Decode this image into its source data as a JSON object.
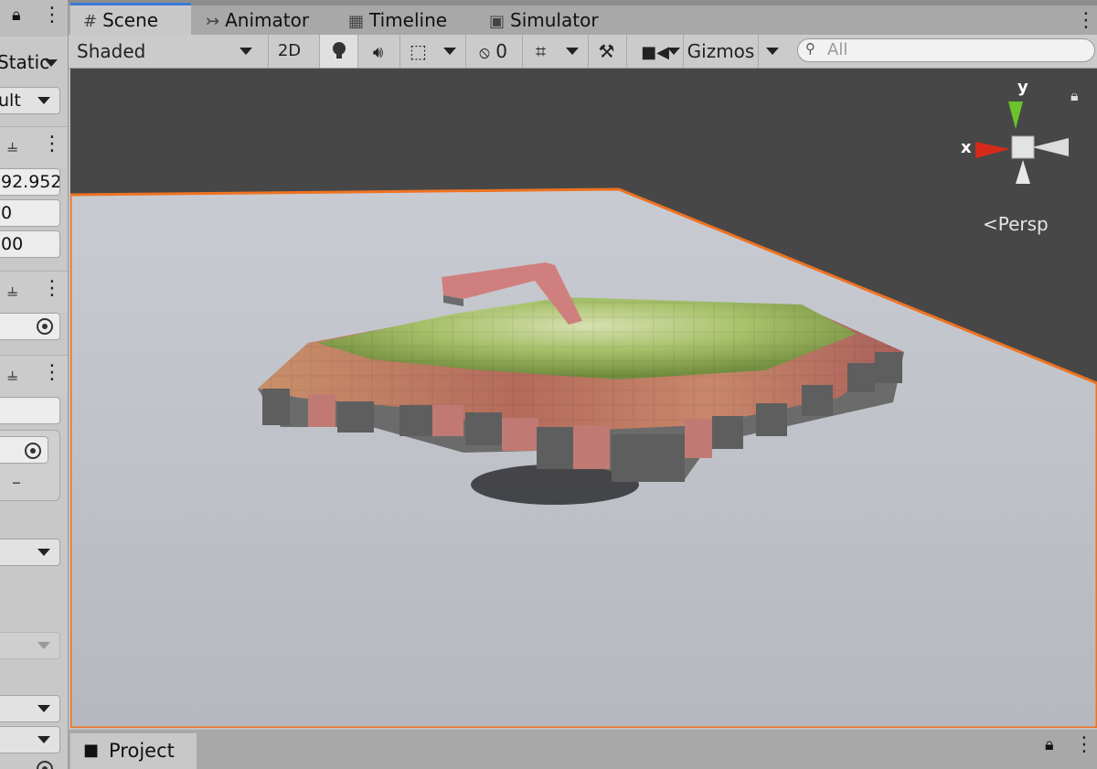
{
  "inspector": {
    "static_label": "Static",
    "layer_value": "ult",
    "field_1": "92.952",
    "field_2": "0",
    "field_3": "00",
    "minus_label": "–"
  },
  "tabs": [
    {
      "label": "Scene",
      "icon": "grid-icon"
    },
    {
      "label": "Animator",
      "icon": "animator-icon"
    },
    {
      "label": "Timeline",
      "icon": "film-icon"
    },
    {
      "label": "Simulator",
      "icon": "device-icon"
    }
  ],
  "toolbar": {
    "draw_mode": "Shaded",
    "mode_2d": "2D",
    "hidden_count": "0",
    "gizmos_label": "Gizmos",
    "search_placeholder": "All"
  },
  "gizmo": {
    "y_label": "y",
    "x_label": "x",
    "persp_label": "Persp"
  },
  "bottom": {
    "project_label": "Project"
  },
  "colors": {
    "selection_outline": "#ee7322",
    "tab_accent": "#3a79d8",
    "gizmo_y": "#6cc32b",
    "gizmo_x": "#d42a1b"
  }
}
